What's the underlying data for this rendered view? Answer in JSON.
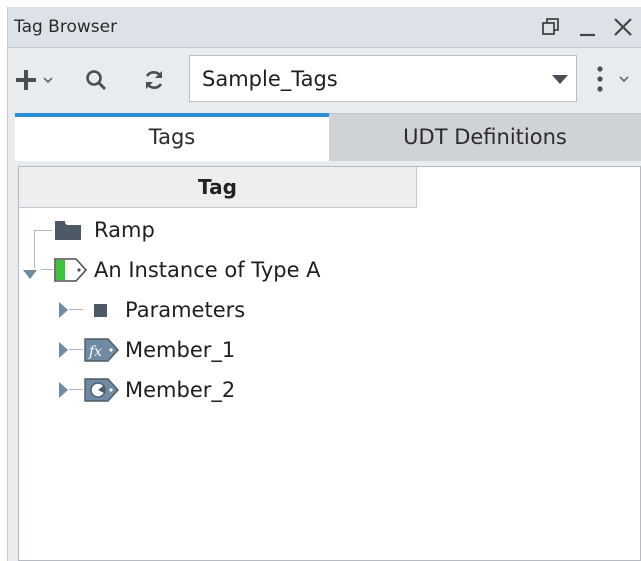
{
  "window": {
    "title": "Tag Browser",
    "controls": [
      "restore-icon",
      "minimize-icon",
      "close-icon"
    ]
  },
  "toolbar": {
    "add_icon": "plus-icon",
    "search_icon": "search-icon",
    "refresh_icon": "refresh-icon",
    "tag_provider": "Sample_Tags",
    "more_icon": "kebab-menu-icon"
  },
  "tabs": [
    {
      "label": "Tags",
      "active": true
    },
    {
      "label": "UDT Definitions",
      "active": false
    }
  ],
  "table": {
    "column_header": "Tag"
  },
  "tree": [
    {
      "label": "Ramp",
      "icon": "folder-icon",
      "depth": 0,
      "expanded": null
    },
    {
      "label": "An Instance of Type A",
      "icon": "udt-instance-icon",
      "depth": 0,
      "expanded": true
    },
    {
      "label": "Parameters",
      "icon": "parameters-icon",
      "depth": 1,
      "expanded": false
    },
    {
      "label": "Member_1",
      "icon": "expression-tag-icon",
      "depth": 1,
      "expanded": false
    },
    {
      "label": "Member_2",
      "icon": "opc-tag-icon",
      "depth": 1,
      "expanded": false
    }
  ],
  "colors": {
    "accent": "#2b8fd6",
    "udt_green": "#3cc43c"
  }
}
